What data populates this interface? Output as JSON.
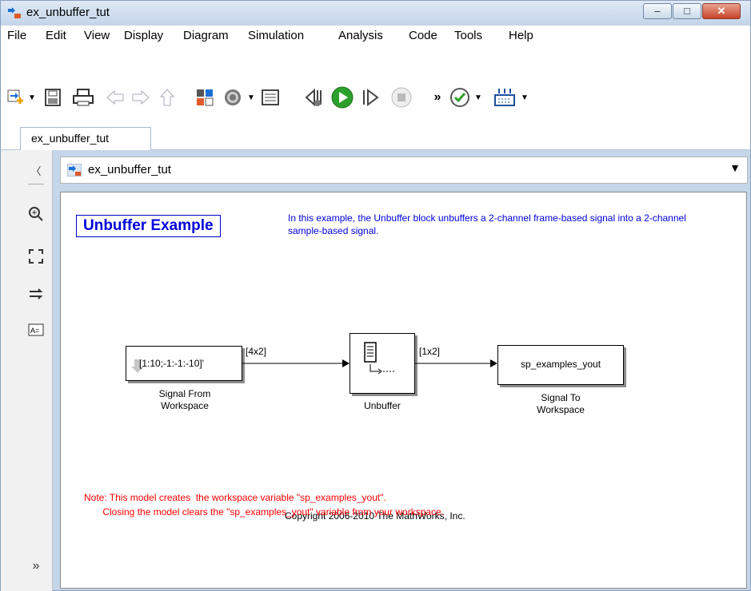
{
  "window": {
    "title": "ex_unbuffer_tut"
  },
  "menu": [
    "File",
    "Edit",
    "View",
    "Display",
    "Diagram",
    "Simulation",
    "Analysis",
    "Code",
    "Tools",
    "Help"
  ],
  "toolbar": {
    "overflow": "»"
  },
  "tab": {
    "label": "ex_unbuffer_tut"
  },
  "address": {
    "path": "ex_unbuffer_tut"
  },
  "leftbar": {
    "expand": "»"
  },
  "model": {
    "heading": "Unbuffer Example",
    "description": "In this example, the Unbuffer block unbuffers a 2-channel frame-based signal into a 2-channel sample-based signal.",
    "blocks": {
      "source": {
        "content": "[1:10;-1:-1:-10]'",
        "label_line1": "Signal From",
        "label_line2": "Workspace"
      },
      "unbuffer": {
        "label": "Unbuffer"
      },
      "sink": {
        "content": "sp_examples_yout",
        "label_line1": "Signal To",
        "label_line2": "Workspace"
      }
    },
    "signals": {
      "source_out": "[4x2]",
      "unbuffer_out": "[1x2]"
    },
    "note": "Note: This model creates  the workspace variable \"sp_examples_yout\".\n       Closing the model clears the \"sp_examples_yout\" variable from your workspace.",
    "copyright": "Copyright 2006-2010 The MathWorks, Inc."
  }
}
